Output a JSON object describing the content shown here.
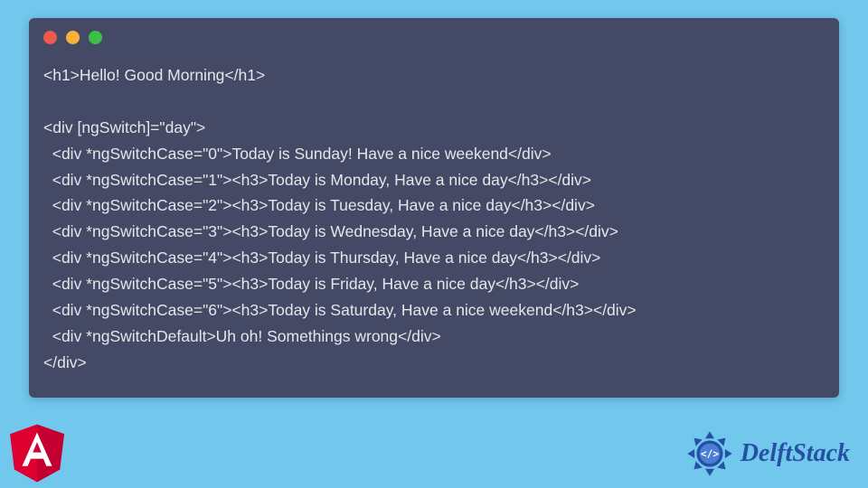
{
  "window": {
    "dots": [
      "red",
      "yellow",
      "green"
    ]
  },
  "code": {
    "lines": [
      "<h1>Hello! Good Morning</h1>",
      "",
      "<div [ngSwitch]=\"day\">",
      "  <div *ngSwitchCase=\"0\">Today is Sunday! Have a nice weekend</div>",
      "  <div *ngSwitchCase=\"1\"><h3>Today is Monday, Have a nice day</h3></div>",
      "  <div *ngSwitchCase=\"2\"><h3>Today is Tuesday, Have a nice day</h3></div>",
      "  <div *ngSwitchCase=\"3\"><h3>Today is Wednesday, Have a nice day</h3></div>",
      "  <div *ngSwitchCase=\"4\"><h3>Today is Thursday, Have a nice day</h3></div>",
      "  <div *ngSwitchCase=\"5\"><h3>Today is Friday, Have a nice day</h3></div>",
      "  <div *ngSwitchCase=\"6\"><h3>Today is Saturday, Have a nice weekend</h3></div>",
      "  <div *ngSwitchDefault>Uh oh! Somethings wrong</div>",
      "</div>"
    ]
  },
  "branding": {
    "right_text": "DelftStack"
  }
}
